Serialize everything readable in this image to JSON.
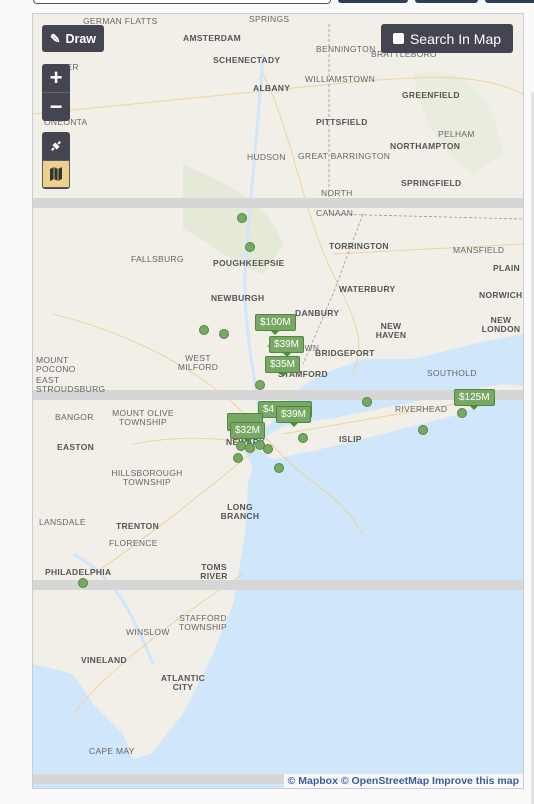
{
  "toolbar": {
    "draw_label": "Draw",
    "search_in_map_label": "Search In Map",
    "zoom_in": "+",
    "zoom_out": "−"
  },
  "icons": {
    "draw": "pencil-icon",
    "search_in_map": "checkbox-icon",
    "satellite": "satellite-icon",
    "streets": "map-icon"
  },
  "colors": {
    "marker": "#79a866",
    "control": "#454552",
    "active_layer": "#ecd08b",
    "water": "#cfe6fb",
    "land": "#f2efe9"
  },
  "places": [
    "German Flatts",
    "Amsterdam",
    "Schenectady",
    "Springs",
    "Exeter",
    "Bennington",
    "Brattleboro",
    "Williamstown",
    "Albany",
    "Greenfield",
    "Oneonta",
    "Pittsfield",
    "Pelham",
    "Northampton",
    "Hudson",
    "Great Barrington",
    "Springfield",
    "North",
    "Canaan",
    "Torrington",
    "Mansfield",
    "Fallsburg",
    "Poughkeepsie",
    "Plain",
    "Waterbury",
    "Norwich",
    "Newburgh",
    "Danbury",
    "New Haven",
    "New London",
    "Mount Pocono",
    "West Milford",
    "Yorktown",
    "Bridgeport",
    "East Stroudsburg",
    "Stamford",
    "Southold",
    "Riverhead",
    "Bangor",
    "Mount Olive Township",
    "Easton",
    "Islip",
    "Newark",
    "Hillsborough Township",
    "Long Branch",
    "Lansdale",
    "Trenton",
    "Florence",
    "Philadelphia",
    "Toms River",
    "Stafford Township",
    "Winslow",
    "Vineland",
    "Atlantic City",
    "Cape May"
  ],
  "price_markers": [
    "$100M",
    "$39M",
    "$35M",
    "$4",
    "$39M",
    "$32M",
    "$125M"
  ],
  "attribution": {
    "mapbox": "© Mapbox",
    "osm": "© OpenStreetMap",
    "improve": "Improve this map"
  }
}
